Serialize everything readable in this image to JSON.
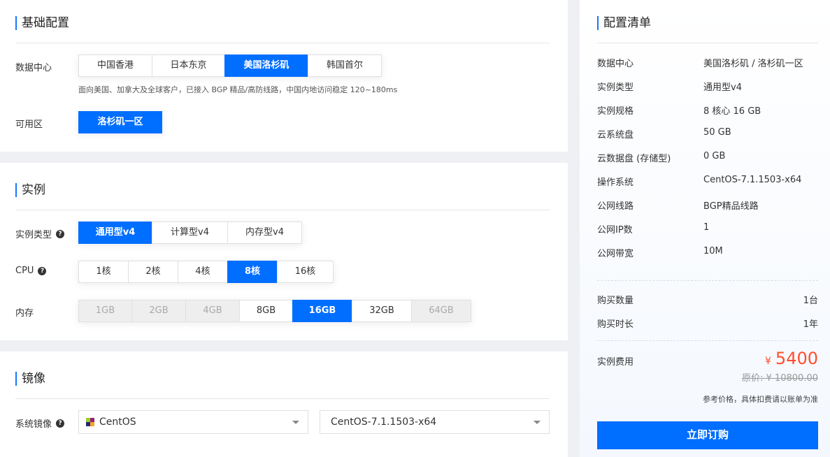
{
  "basic": {
    "title": "基础配置",
    "datacenter_label": "数据中心",
    "datacenters": [
      "中国香港",
      "日本东京",
      "美国洛杉矶",
      "韩国首尔"
    ],
    "datacenter_selected": 2,
    "datacenter_hint": "面向美国、加拿大及全球客户，已接入 BGP 精品/高防线路，中国内地访问稳定 120~180ms",
    "zone_label": "可用区",
    "zones": [
      "洛杉矶一区"
    ]
  },
  "instance": {
    "title": "实例",
    "type_label": "实例类型",
    "types": [
      "通用型v4",
      "计算型v4",
      "内存型v4"
    ],
    "cpu_label": "CPU",
    "cpus": [
      "1核",
      "2核",
      "4核",
      "8核",
      "16核"
    ],
    "mem_label": "内存",
    "mems": [
      "1GB",
      "2GB",
      "4GB",
      "8GB",
      "16GB",
      "32GB",
      "64GB"
    ]
  },
  "image": {
    "title": "镜像",
    "label": "系统镜像",
    "os": "CentOS",
    "version": "CentOS-7.1.1503-x64"
  },
  "summary": {
    "title": "配置清单",
    "rows": [
      {
        "k": "数据中心",
        "v": "美国洛杉矶 / 洛杉矶一区"
      },
      {
        "k": "实例类型",
        "v": "通用型v4"
      },
      {
        "k": "实例规格",
        "v": "8 核心 16 GB"
      },
      {
        "k": "云系统盘",
        "v": "50 GB"
      },
      {
        "k": "云数据盘 (存储型)",
        "v": "0 GB"
      },
      {
        "k": "操作系统",
        "v": "CentOS-7.1.1503-x64"
      },
      {
        "k": "公网线路",
        "v": "BGP精品线路"
      },
      {
        "k": "公网IP数",
        "v": "1"
      },
      {
        "k": "公网带宽",
        "v": "10M"
      }
    ],
    "qty_label": "购买数量",
    "qty_value": "1台",
    "duration_label": "购买时长",
    "duration_value": "1年",
    "fee_label": "实例费用",
    "currency": "¥",
    "price": "5400",
    "original_price": "原价: ¥ 10800.00",
    "note": "参考价格，具体扣费请以账单为准",
    "buy_label": "立即订购"
  },
  "colors": {
    "accent": "#006eff",
    "price": "#ff4d2e"
  }
}
